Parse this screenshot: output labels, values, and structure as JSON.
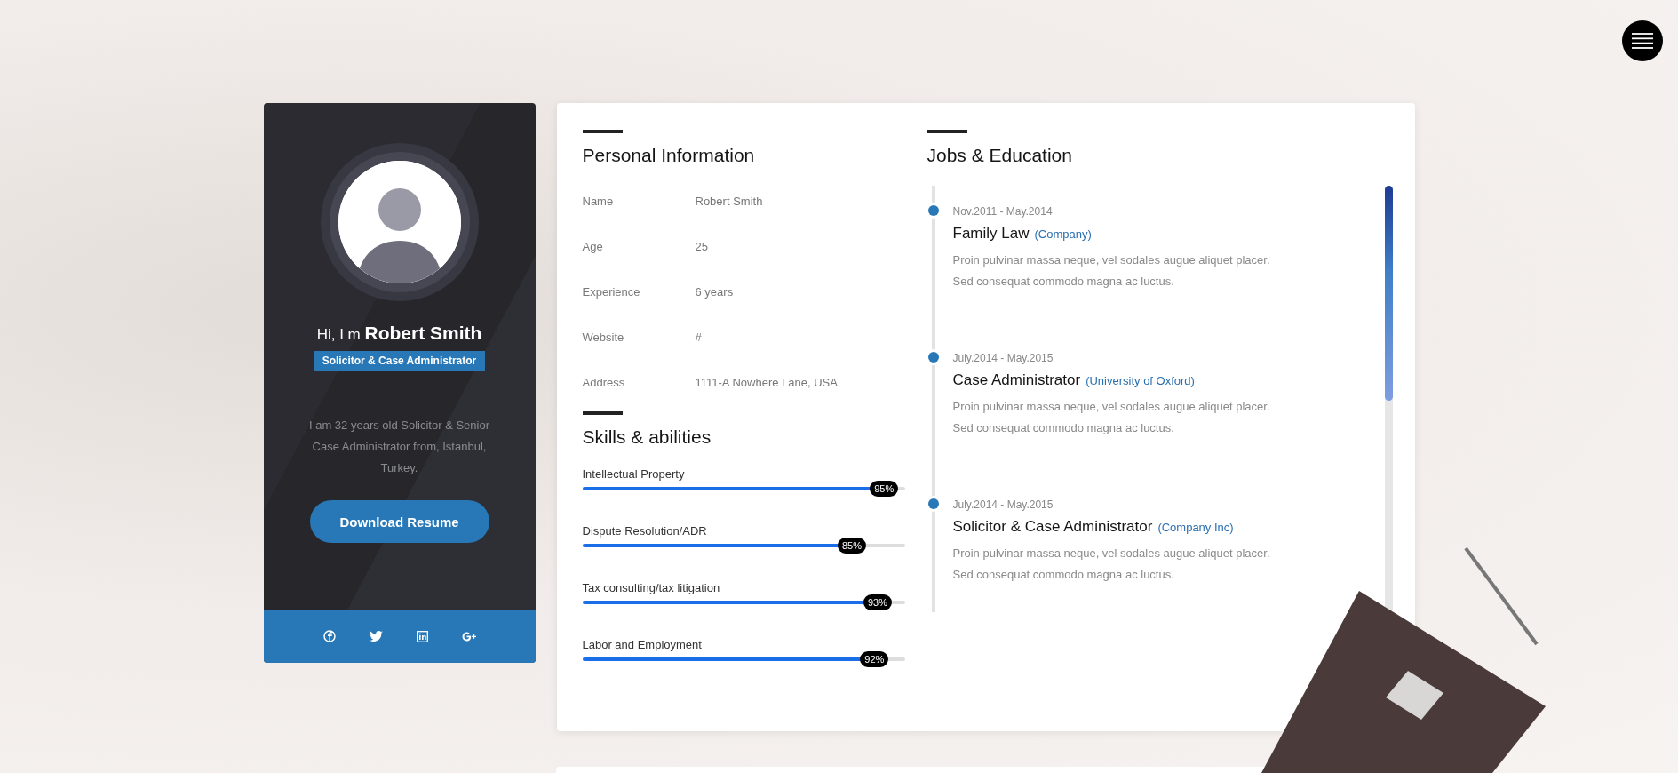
{
  "profile": {
    "greeting": "Hi, I m **Robert Smith**",
    "role": "Solicitor & Case Administrator",
    "bio": "I am 32 years old Solicitor & Senior Case Administrator from, Istanbul, Turkey.",
    "button": "Download Resume",
    "social": [
      {
        "kind": "facebook"
      },
      {
        "kind": "twitter"
      },
      {
        "kind": "linkedin"
      },
      {
        "kind": "googleplus"
      }
    ]
  },
  "personal_info": {
    "heading": "Personal Information",
    "rows": [
      {
        "label": "Name",
        "value": "Robert Smith"
      },
      {
        "label": "Age",
        "value": "25"
      },
      {
        "label": "Experience",
        "value": "6 years"
      },
      {
        "label": "Website",
        "value": "#"
      },
      {
        "label": "Address",
        "value": "1111-A Nowhere Lane, USA"
      }
    ]
  },
  "skills": {
    "heading": "Skills & abilities",
    "items": [
      {
        "name": "Intellectual Property",
        "level": 0.95,
        "reading": "95%"
      },
      {
        "name": "Dispute Resolution/ADR",
        "level": 0.85,
        "reading": "85%"
      },
      {
        "name": "Tax consulting/tax litigation",
        "level": 0.93,
        "reading": "93%"
      },
      {
        "name": "Labor and Employment",
        "level": 0.92,
        "reading": "92%"
      }
    ]
  },
  "jobs": {
    "heading": "Jobs & Education",
    "entries": [
      {
        "dates": "Nov.2011 - May.2014",
        "title": "Family Law",
        "org": "(Company)",
        "description": "Proin pulvinar massa neque, vel sodales augue aliquet placer. Sed consequat commodo magna ac luctus."
      },
      {
        "dates": "July.2014 - May.2015",
        "title": "Case Administrator",
        "org": "(University of Oxford)",
        "description": "Proin pulvinar massa neque, vel sodales augue aliquet placer. Sed consequat commodo magna ac luctus."
      },
      {
        "dates": "July.2014 - May.2015",
        "title": "Solicitor & Case Administrator",
        "org": "(Company Inc)",
        "description": "Proin pulvinar massa neque, vel sodales augue aliquet placer. Sed consequat commodo magna ac luctus."
      }
    ]
  }
}
